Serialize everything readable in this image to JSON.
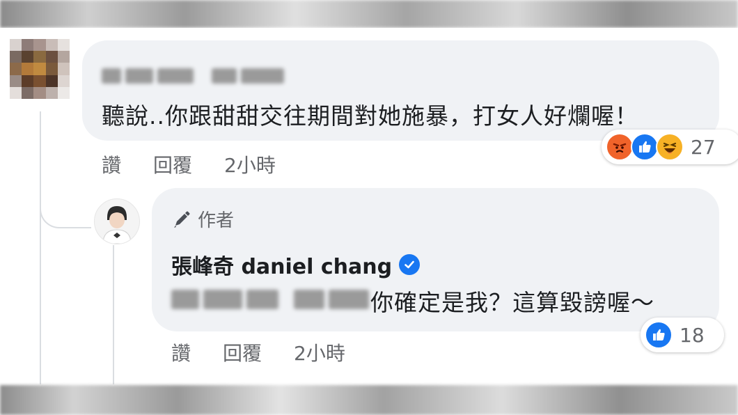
{
  "comment1": {
    "text": "聽說..你跟甜甜交往期間對她施暴，打女人好爛喔！",
    "actions": {
      "like": "讚",
      "reply": "回覆",
      "time": "2小時"
    },
    "reactions": {
      "icons": [
        "angry-reaction",
        "like-reaction",
        "haha-reaction"
      ],
      "count": "27"
    }
  },
  "reply": {
    "badge": "作者",
    "author": "張峰奇 daniel chang",
    "text": "你確定是我？這算毀謗喔～",
    "actions": {
      "like": "讚",
      "reply": "回覆",
      "time": "2小時"
    },
    "reactions": {
      "icons": [
        "like-reaction"
      ],
      "count": "18"
    }
  },
  "colors": {
    "bubble": "#f0f2f5",
    "facebook_blue": "#1877f2",
    "angry": "#f0632a",
    "haha": "#f7b125",
    "meta_text": "#65676b"
  }
}
